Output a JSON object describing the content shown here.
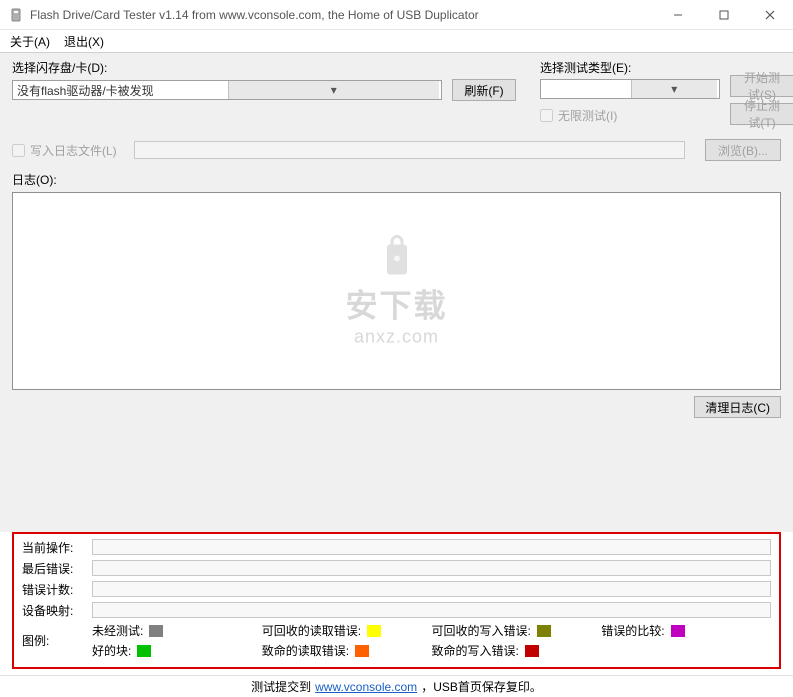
{
  "title": "Flash Drive/Card Tester v1.14 from www.vconsole.com, the Home of USB Duplicator",
  "menu": {
    "about": "关于(A)",
    "exit": "退出(X)"
  },
  "selectDrive": {
    "label": "选择闪存盘/卡(D):",
    "value": "没有flash驱动器/卡被发现",
    "refresh": "刷新(F)"
  },
  "testType": {
    "label": "选择测试类型(E):",
    "unlimited": "无限测试(I)"
  },
  "buttons": {
    "start": "开始测试(S)",
    "stop": "停止测试(T)",
    "browse": "浏览(B)...",
    "clearLog": "清理日志(C)"
  },
  "writeLog": "写入日志文件(L)",
  "logLabel": "日志(O):",
  "watermark": {
    "cn": "安下载",
    "en": "anxz.com"
  },
  "status": {
    "currentOp": "当前操作:",
    "lastError": "最后错误:",
    "errorCount": "错误计数:",
    "deviceMap": "设备映射:",
    "legendLabel": "图例:",
    "legend": {
      "untested": "未经测试:",
      "recoverableRead": "可回收的读取错误:",
      "recoverableWrite": "可回收的写入错误:",
      "compareError": "错误的比较:",
      "goodBlock": "好的块:",
      "fatalRead": "致命的读取错误:",
      "fatalWrite": "致命的写入错误:"
    },
    "colors": {
      "untested": "#808080",
      "recoverableRead": "#ffff00",
      "recoverableWrite": "#808000",
      "compareError": "#c000c0",
      "goodBlock": "#00c000",
      "fatalRead": "#ff6000",
      "fatalWrite": "#c00000"
    }
  },
  "footer": {
    "pre": "测试提交到",
    "link": "www.vconsole.com",
    "post": "，USB首页保存复印。"
  }
}
